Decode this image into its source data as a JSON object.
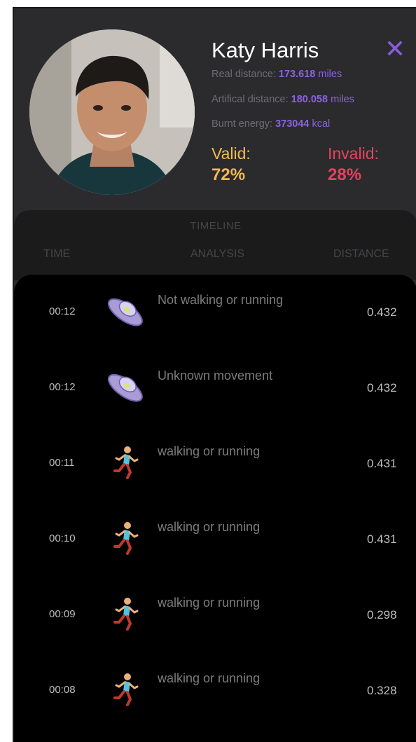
{
  "profile": {
    "name": "Katy Harris",
    "real_distance_label": "Real distance: ",
    "real_distance_value": "173.618",
    "real_distance_unit": " miles",
    "artificial_distance_label": "Artifical distance: ",
    "artificial_distance_value": "180.058",
    "artificial_distance_unit": " miles",
    "burnt_energy_label": "Burnt energy: ",
    "burnt_energy_value": "373044",
    "burnt_energy_unit": " kcal",
    "valid_label": "Valid:",
    "valid_percent": "72%",
    "invalid_label": "Invalid:",
    "invalid_percent": "28%",
    "close_symbol": "✕"
  },
  "timeline": {
    "title": "TIMELINE",
    "columns": {
      "time": "TIME",
      "analysis": "ANALYSIS",
      "distance": "DISTANCE"
    },
    "rows": [
      {
        "time": "00:12",
        "analysis": "Not walking or running",
        "distance": "0.432",
        "icon": "ufo-icon"
      },
      {
        "time": "00:12",
        "analysis": "Unknown movement",
        "distance": "0.432",
        "icon": "ufo-icon"
      },
      {
        "time": "00:11",
        "analysis": "walking or running",
        "distance": "0.431",
        "icon": "runner-icon"
      },
      {
        "time": "00:10",
        "analysis": "walking or running",
        "distance": "0.431",
        "icon": "runner-icon"
      },
      {
        "time": "00:09",
        "analysis": "walking or running",
        "distance": "0.298",
        "icon": "runner-icon"
      },
      {
        "time": "00:08",
        "analysis": "walking or running",
        "distance": "0.328",
        "icon": "runner-icon"
      }
    ]
  },
  "colors": {
    "background": "#2b2b2d",
    "accent": "#8c63dd",
    "valid": "#f2b957",
    "invalid": "#e2435f"
  }
}
